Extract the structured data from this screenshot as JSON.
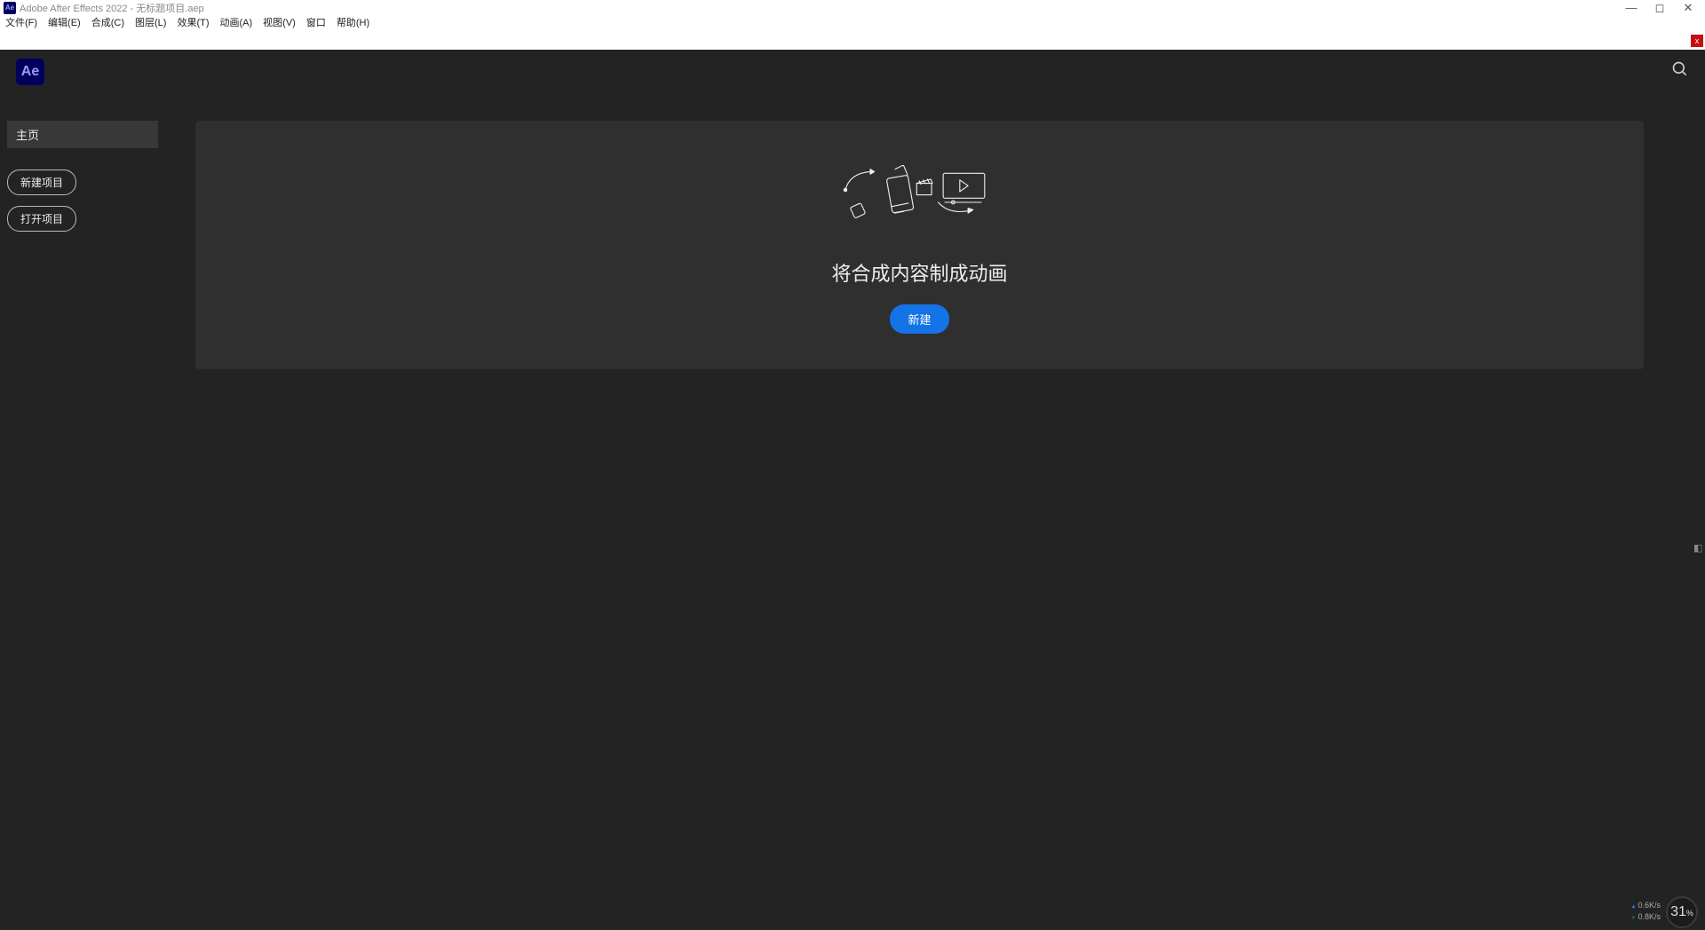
{
  "titlebar": {
    "icon_label": "Ae",
    "title": "Adobe After Effects 2022 - 无标题项目.aep"
  },
  "menu": {
    "items": [
      "文件(F)",
      "编辑(E)",
      "合成(C)",
      "图层(L)",
      "效果(T)",
      "动画(A)",
      "视图(V)",
      "窗口",
      "帮助(H)"
    ]
  },
  "strip": {
    "close_label": "x"
  },
  "header": {
    "logo_label": "Ae"
  },
  "sidebar": {
    "tab_home": "主页",
    "new_project": "新建项目",
    "open_project": "打开项目"
  },
  "hero": {
    "title": "将合成内容制成动画",
    "cta": "新建"
  },
  "netwidget": {
    "up": "0.6K/s",
    "down": "0.8K/s",
    "pct": "31",
    "pct_sym": "%"
  }
}
